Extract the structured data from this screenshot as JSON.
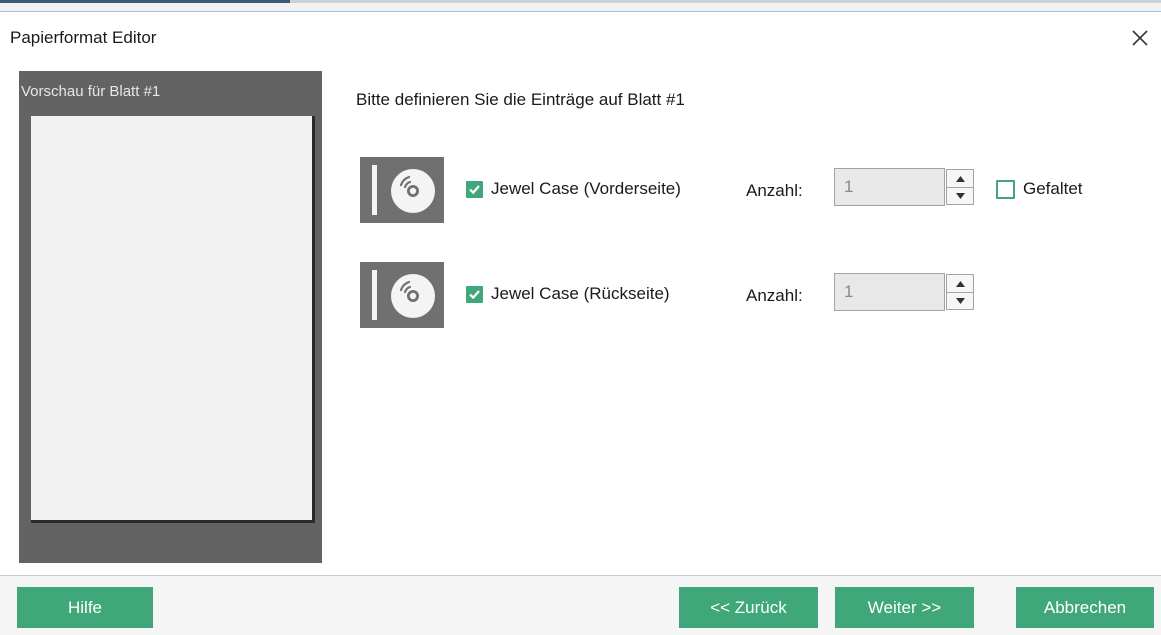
{
  "dialog": {
    "title": "Papierformat Editor",
    "accent_color": "#3fa779"
  },
  "preview": {
    "label": "Vorschau für Blatt #1"
  },
  "main": {
    "instruction": "Bitte definieren Sie die Einträge auf Blatt #1",
    "entries": [
      {
        "icon": "disc-icon",
        "checked": true,
        "label": "Jewel Case (Vorderseite)",
        "count_label": "Anzahl:",
        "count_value": "1",
        "folded_label": "Gefaltet",
        "folded_checked": false
      },
      {
        "icon": "disc-icon",
        "checked": true,
        "label": "Jewel Case (Rückseite)",
        "count_label": "Anzahl:",
        "count_value": "1"
      }
    ]
  },
  "footer": {
    "help_label": "Hilfe",
    "back_label": "<< Zurück",
    "next_label": "Weiter >>",
    "cancel_label": "Abbrechen"
  }
}
